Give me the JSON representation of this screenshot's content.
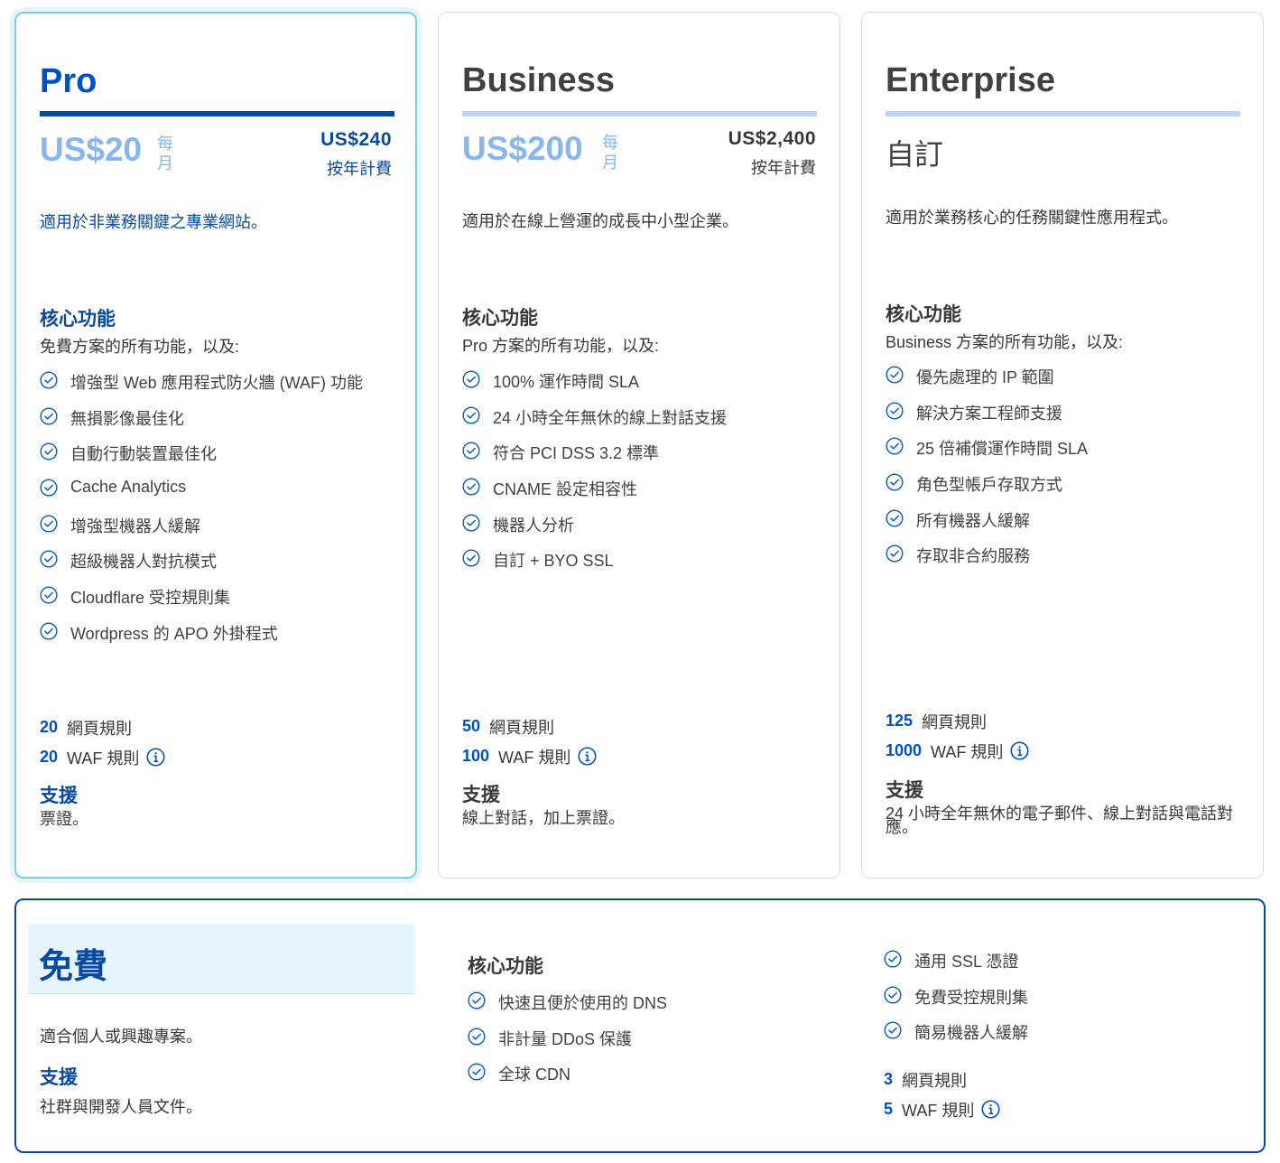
{
  "colors": {
    "accent": "#0051c3",
    "dark_blue": "#0a4a9c",
    "light_price": "#89b7ec",
    "pro_border": "#7fcfe3"
  },
  "plans": {
    "pro": {
      "name": "Pro",
      "price": "US$20",
      "per": "每月",
      "yearly_amount": "US$240",
      "yearly_label": "按年計費",
      "description": "適用於非業務關鍵之專業網站。",
      "core_title": "核心功能",
      "core_sub": "免費方案的所有功能，以及:",
      "features": [
        "增強型 Web 應用程式防火牆 (WAF) 功能",
        "無損影像最佳化",
        "自動行動裝置最佳化",
        "Cache Analytics",
        "增強型機器人緩解",
        "超級機器人對抗模式",
        "Cloudflare 受控規則集",
        "Wordpress 的 APO 外掛程式"
      ],
      "page_rules_count": "20",
      "page_rules_label": "網頁規則",
      "waf_rules_count": "20",
      "waf_rules_label": "WAF 規則",
      "support_title": "支援",
      "support_text": "票證。"
    },
    "business": {
      "name": "Business",
      "price": "US$200",
      "per": "每月",
      "yearly_amount": "US$2,400",
      "yearly_label": "按年計費",
      "description": "適用於在線上營運的成長中小型企業。",
      "core_title": "核心功能",
      "core_sub": "Pro 方案的所有功能，以及:",
      "features": [
        "100% 運作時間 SLA",
        "24 小時全年無休的線上對話支援",
        "符合 PCI DSS 3.2 標準",
        "CNAME 設定相容性",
        "機器人分析",
        "自訂 + BYO SSL"
      ],
      "page_rules_count": "50",
      "page_rules_label": "網頁規則",
      "waf_rules_count": "100",
      "waf_rules_label": "WAF 規則",
      "support_title": "支援",
      "support_text": "線上對話，加上票證。"
    },
    "enterprise": {
      "name": "Enterprise",
      "price": "自訂",
      "description": "適用於業務核心的任務關鍵性應用程式。",
      "core_title": "核心功能",
      "core_sub": "Business 方案的所有功能，以及:",
      "features": [
        "優先處理的 IP 範圍",
        "解決方案工程師支援",
        "25 倍補償運作時間 SLA",
        "角色型帳戶存取方式",
        "所有機器人緩解",
        "存取非合約服務"
      ],
      "page_rules_count": "125",
      "page_rules_label": "網頁規則",
      "waf_rules_count": "1000",
      "waf_rules_label": "WAF 規則",
      "support_title": "支援",
      "support_text": "24 小時全年無休的電子郵件、線上對話與電話對應。"
    },
    "free": {
      "name": "免費",
      "description": "適合個人或興趣專案。",
      "support_title": "支援",
      "support_text": "社群與開發人員文件。",
      "core_title": "核心功能",
      "features_left": [
        "快速且便於使用的 DNS",
        "非計量 DDoS 保護",
        "全球 CDN"
      ],
      "features_right": [
        "通用 SSL 憑證",
        "免費受控規則集",
        "簡易機器人緩解"
      ],
      "page_rules_count": "3",
      "page_rules_label": "網頁規則",
      "waf_rules_count": "5",
      "waf_rules_label": "WAF 規則"
    }
  },
  "icons": {
    "check": "check-circle-icon",
    "info": "info-icon"
  }
}
